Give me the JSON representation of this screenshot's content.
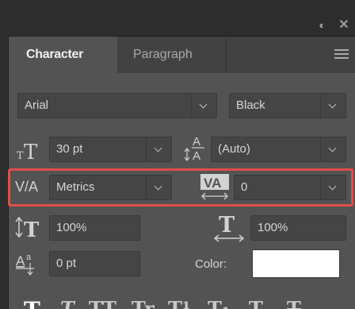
{
  "window": {
    "collapse_glyph": "‹‹",
    "close_glyph": "✕"
  },
  "tabs": [
    {
      "label": "Character",
      "active": true
    },
    {
      "label": "Paragraph",
      "active": false
    }
  ],
  "font": {
    "family": "Arial",
    "style": "Black"
  },
  "size": {
    "value": "30 pt",
    "icon": "font-size-icon"
  },
  "leading": {
    "value": "(Auto)",
    "icon": "leading-icon"
  },
  "kerning": {
    "value": "Metrics",
    "icon": "kerning-icon"
  },
  "tracking": {
    "value": "0",
    "icon": "tracking-icon"
  },
  "vertical_scale": {
    "value": "100%",
    "icon": "vertical-scale-icon"
  },
  "horizontal_scale": {
    "value": "100%",
    "icon": "horizontal-scale-icon"
  },
  "baseline_shift": {
    "value": "0 pt",
    "icon": "baseline-shift-icon"
  },
  "color": {
    "label": "Color:",
    "value": "#ffffff"
  },
  "colors": {
    "panel": "#535353",
    "highlight": "#e14d4b",
    "tab_bar": "#424242"
  },
  "style_buttons": [
    "T",
    "T",
    "TT",
    "Tr",
    "T¹",
    "T₁",
    "T",
    "T"
  ]
}
